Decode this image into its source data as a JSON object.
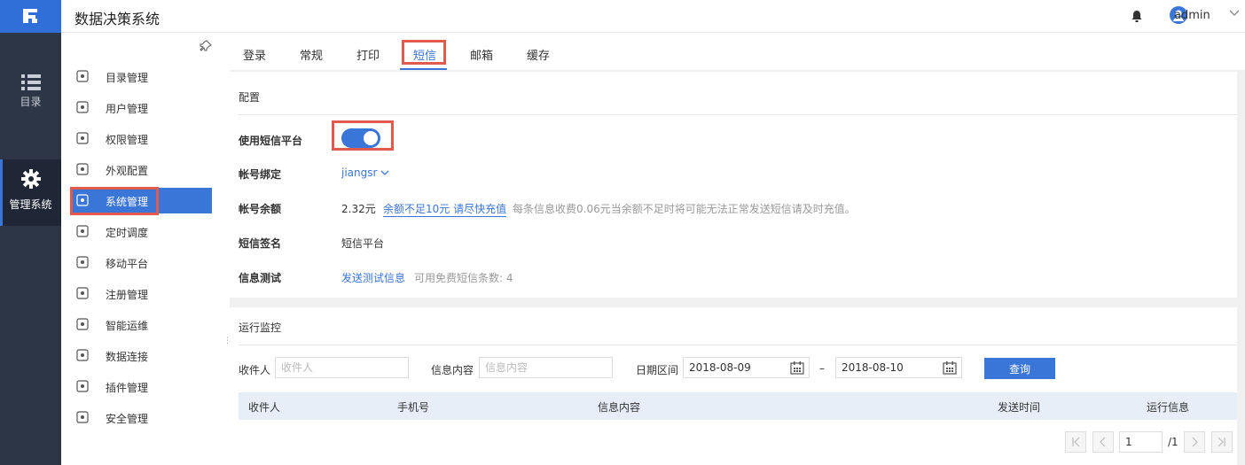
{
  "app": {
    "title": "数据决策系统",
    "user": "admin",
    "accent": "#3a75d8",
    "highlight": "#e05a4e"
  },
  "leftnav": [
    {
      "label": "目录",
      "icon": "list-icon"
    },
    {
      "label": "管理系统",
      "icon": "gear-icon"
    }
  ],
  "menu": [
    {
      "label": "目录管理",
      "icon": "directory-icon"
    },
    {
      "label": "用户管理",
      "icon": "user-icon"
    },
    {
      "label": "权限管理",
      "icon": "lock-icon"
    },
    {
      "label": "外观配置",
      "icon": "paint-roller-icon"
    },
    {
      "label": "系统管理",
      "icon": "gear-icon"
    },
    {
      "label": "定时调度",
      "icon": "timer-icon"
    },
    {
      "label": "移动平台",
      "icon": "mobile-icon"
    },
    {
      "label": "注册管理",
      "icon": "register-icon"
    },
    {
      "label": "智能运维",
      "icon": "network-icon"
    },
    {
      "label": "数据连接",
      "icon": "link-icon"
    },
    {
      "label": "插件管理",
      "icon": "puzzle-icon"
    },
    {
      "label": "安全管理",
      "icon": "shield-icon"
    }
  ],
  "tabs": [
    "登录",
    "常规",
    "打印",
    "短信",
    "邮箱",
    "缓存"
  ],
  "config": {
    "title": "配置",
    "use_platform_label": "使用短信平台",
    "account_label": "帐号绑定",
    "account_value": "jiangsr",
    "balance_label": "帐号余额",
    "balance_value": "2.32元",
    "balance_link": "余额不足10元 请尽快充值",
    "balance_note": "每条信息收费0.06元当余额不足时将可能无法正常发送短信请及时充值。",
    "sign_label": "短信签名",
    "sign_value": "短信平台",
    "test_label": "信息测试",
    "test_link": "发送测试信息",
    "test_note": "可用免费短信条数:  4"
  },
  "monitor": {
    "title": "运行监控",
    "receiver_label": "收件人",
    "receiver_placeholder": "收件人",
    "content_label": "信息内容",
    "content_placeholder": "信息内容",
    "date_label": "日期区间",
    "date_from": "2018-08-09",
    "date_sep": "–",
    "date_to": "2018-08-10",
    "query_button": "查询",
    "columns": [
      "收件人",
      "手机号",
      "信息内容",
      "发送时间",
      "运行信息"
    ],
    "page": "1",
    "page_total": "/1"
  }
}
